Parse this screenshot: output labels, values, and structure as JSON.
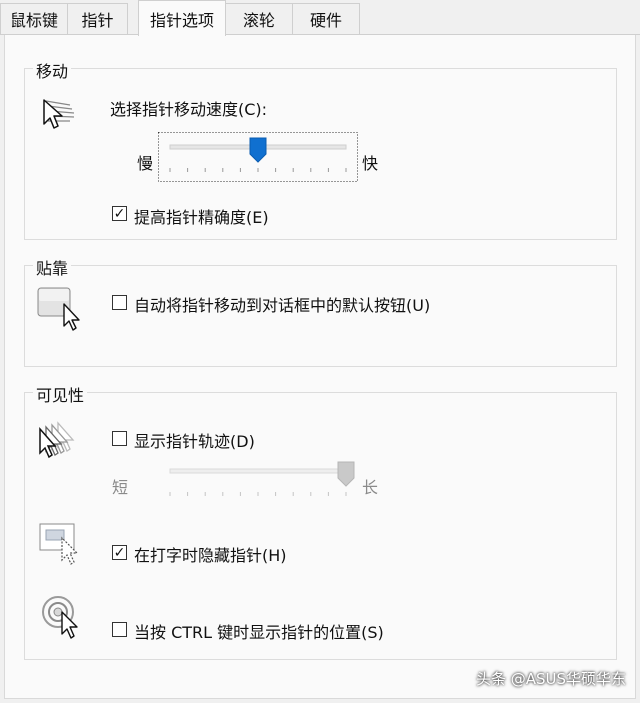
{
  "tabs": [
    {
      "label": "鼠标键",
      "active": false
    },
    {
      "label": "指针",
      "active": false
    },
    {
      "label": "指针选项",
      "active": true
    },
    {
      "label": "滚轮",
      "active": false
    },
    {
      "label": "硬件",
      "active": false
    }
  ],
  "motion": {
    "title": "移动",
    "speed_label": "选择指针移动速度(C):",
    "speed_min_label": "慢",
    "speed_max_label": "快",
    "speed_value": 0.5,
    "precision_label": "提高指针精确度(E)",
    "precision_checked": true
  },
  "snap": {
    "title": "贴靠",
    "snap_label": "自动将指针移动到对话框中的默认按钮(U)",
    "snap_checked": false
  },
  "visibility": {
    "title": "可见性",
    "trails_label": "显示指针轨迹(D)",
    "trails_checked": false,
    "trails_min_label": "短",
    "trails_max_label": "长",
    "trails_value": 1.0,
    "hide_label": "在打字时隐藏指针(H)",
    "hide_checked": true,
    "ctrl_label": "当按 CTRL 键时显示指针的位置(S)",
    "ctrl_checked": false
  },
  "watermark": "头条 @ASUS华硕华东",
  "icons": {
    "motion": "pointer-speed-icon",
    "snap": "snap-to-icon",
    "trails": "pointer-trails-icon",
    "hide": "hide-while-typing-icon",
    "ctrl": "ctrl-locate-icon"
  }
}
